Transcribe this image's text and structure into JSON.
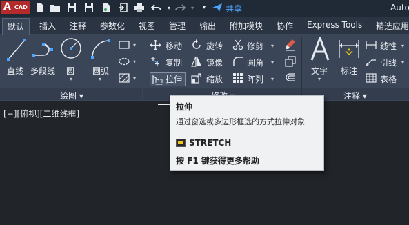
{
  "titlebar": {
    "logo_letter": "A",
    "logo_text": "CAD",
    "share_label": "共享",
    "app_title": "Autoc"
  },
  "tabs": [
    "默认",
    "插入",
    "注释",
    "参数化",
    "视图",
    "管理",
    "输出",
    "附加模块",
    "协作",
    "Express Tools",
    "精选应用"
  ],
  "draw_panel": {
    "title": "绘图 ▾",
    "tools": [
      "直线",
      "多段线",
      "圆",
      "圆弧"
    ]
  },
  "modify_panel": {
    "title": "修改 ▾",
    "tools": [
      "移动",
      "旋转",
      "修剪",
      "复制",
      "镜像",
      "圆角",
      "拉伸",
      "缩放",
      "阵列"
    ]
  },
  "annotation_panel": {
    "title": "注释 ▾",
    "tools": [
      "文字",
      "标注",
      "线性",
      "引线",
      "表格"
    ]
  },
  "canvas": {
    "viewport_label": "[−][俯视][二维线框]"
  },
  "tooltip": {
    "title": "拉伸",
    "description": "通过窗选或多边形框选的方式拉伸对象",
    "command": "STRETCH",
    "help": "按 F1 键获得更多帮助"
  },
  "colors": {
    "accent_blue": "#4ea3ff",
    "logo_red": "#b52a2a",
    "ribbon_bg": "#3a4558",
    "canvas_bg": "#212429"
  }
}
